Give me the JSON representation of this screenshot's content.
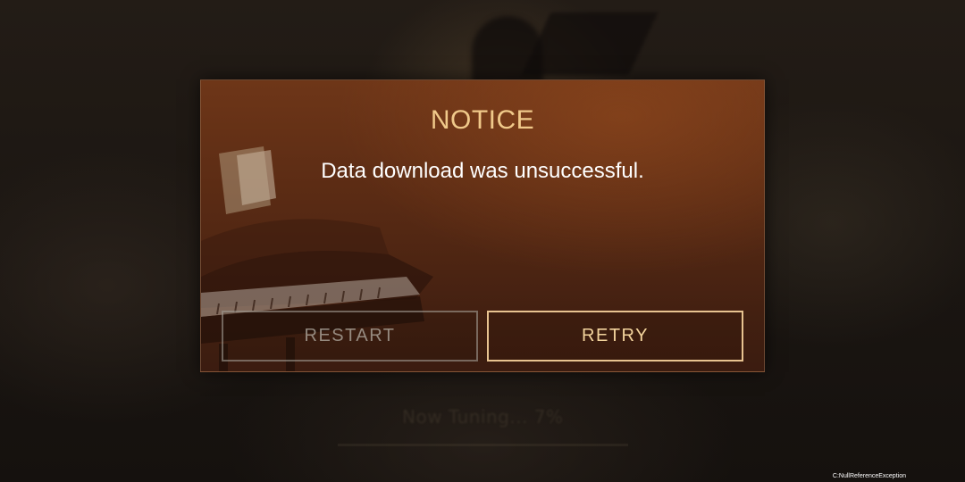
{
  "dialog": {
    "title": "NOTICE",
    "message": "Data download was unsuccessful.",
    "buttons": {
      "restart": "RESTART",
      "retry": "RETRY"
    }
  },
  "background": {
    "status_text": "Now Tuning... 7%",
    "progress": 0.07
  },
  "error_text": "C:NullReferenceException",
  "colors": {
    "title": "#f0c98a",
    "retry_border": "#e8c390",
    "dialog_bg": "#5a2b14"
  },
  "icons": {
    "piano": "grand-piano-illustration"
  }
}
